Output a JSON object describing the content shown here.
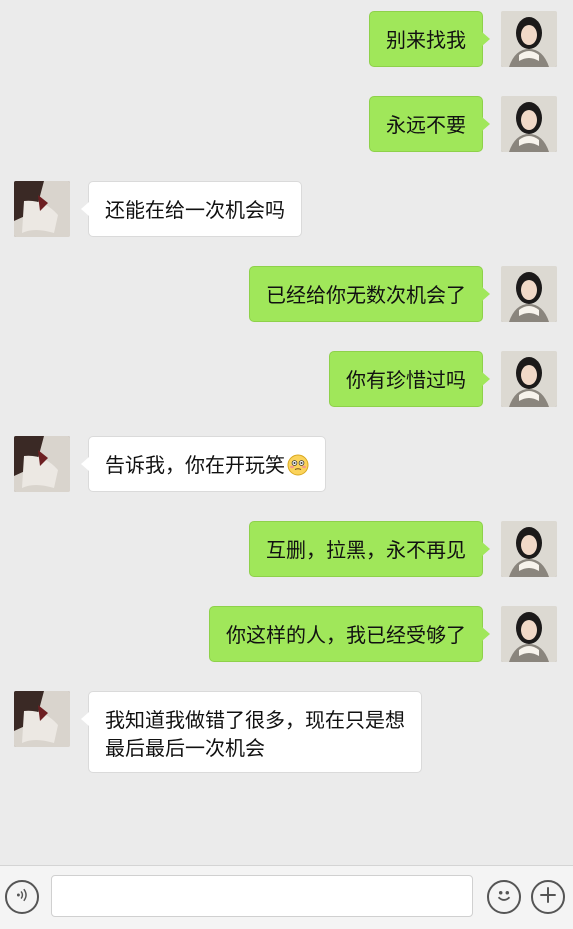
{
  "messages": [
    {
      "side": "me",
      "text": "别来找我"
    },
    {
      "side": "me",
      "text": "永远不要"
    },
    {
      "side": "them",
      "text": "还能在给一次机会吗"
    },
    {
      "side": "me",
      "text": "已经给你无数次机会了"
    },
    {
      "side": "me",
      "text": "你有珍惜过吗"
    },
    {
      "side": "them",
      "text": "告诉我，你在开玩笑",
      "emoji": "flushed-face-icon"
    },
    {
      "side": "me",
      "text": "互删，拉黑，永不再见"
    },
    {
      "side": "me",
      "text": "你这样的人，我已经受够了"
    },
    {
      "side": "them",
      "text": "我知道我做错了很多，现在只是想\n最后最后一次机会"
    }
  ],
  "input_bar": {
    "left_icon": "voice-icon",
    "placeholder": "",
    "right_icons": [
      "emoji-icon",
      "plus-icon"
    ]
  },
  "colors": {
    "background": "#ebebeb",
    "sent_bubble": "#a0e75a",
    "received_bubble": "#ffffff"
  }
}
